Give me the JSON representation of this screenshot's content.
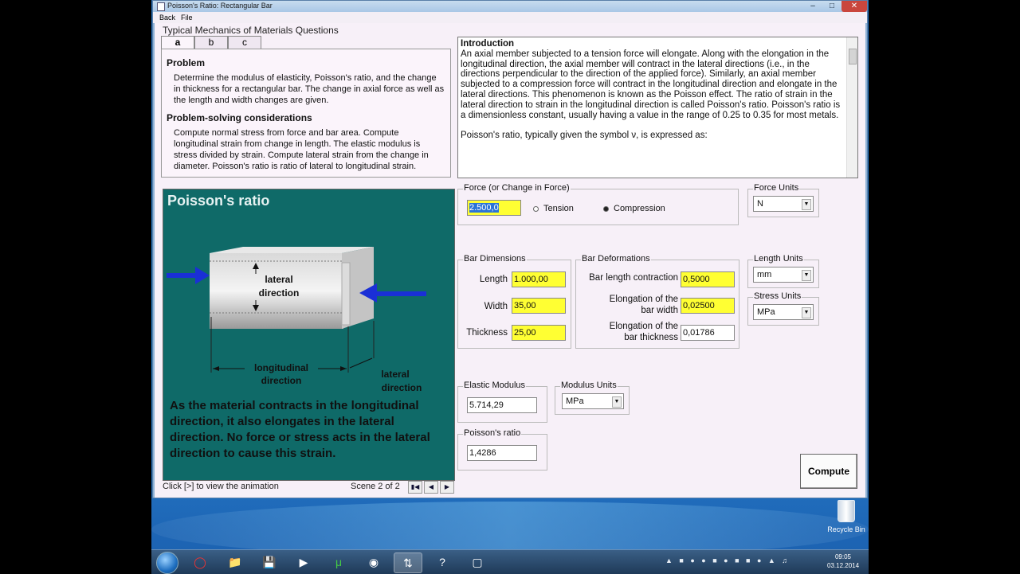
{
  "window": {
    "title": "Poisson's Ratio: Rectangular Bar",
    "menu": [
      "Back",
      "File"
    ]
  },
  "section_title": "Typical Mechanics of Materials Questions",
  "tabs": [
    {
      "label": "a"
    },
    {
      "label": "b"
    },
    {
      "label": "c"
    }
  ],
  "question": {
    "problem_heading": "Problem",
    "problem_text": "Determine the modulus of elasticity, Poisson's ratio, and the change in thickness for a rectangular bar.  The change in axial force as well as the length and width changes are given.",
    "considerations_heading": "Problem-solving considerations",
    "considerations_text": "Compute normal stress from force and bar area. Compute longitudinal strain from change in length. The elastic modulus is stress divided by strain. Compute lateral strain from the change in diameter. Poisson's ratio is ratio of lateral to longitudinal strain."
  },
  "intro": {
    "heading": "Introduction",
    "p1": "An axial member subjected to a tension force will elongate.  Along with the elongation in the longitudinal direction, the axial member will contract in the lateral directions (i.e., in the directions perpendicular to the direction of the applied force).  Similarly, an axial member subjected to a compression force will contract in the longitudinal direction and elongate in the lateral directions.  This phenomenon is known as the Poisson effect.  The ratio of strain in the lateral direction to strain in the longitudinal direction is called Poisson's ratio.  Poisson's ratio is a dimensionless constant, usually having a value in the range of 0.25 to 0.35 for most metals.",
    "p2": "Poisson's ratio, typically given the symbol ν,  is expressed as:"
  },
  "animation": {
    "title": "Poisson's ratio",
    "label_lateral_1": "lateral",
    "label_lateral_2": "direction",
    "label_longitudinal_1": "longitudinal",
    "label_longitudinal_2": "direction",
    "label_lateral_b1": "lateral",
    "label_lateral_b2": "direction",
    "caption": "As the material contracts in the longitudinal direction, it also elongates in the lateral direction.  No force or stress acts in the lateral direction to cause this strain.",
    "hint": "Click [>] to view the animation",
    "scene": "Scene 2 of 2",
    "colors": {
      "background": "#0f6a68",
      "arrow": "#1a2fd6"
    }
  },
  "force": {
    "group_label": "Force (or Change in Force)",
    "value": "2.500,0",
    "option_tension": "Tension",
    "option_compression": "Compression",
    "selected": "Compression"
  },
  "force_units": {
    "label": "Force Units",
    "value": "N"
  },
  "dimensions": {
    "group_label": "Bar Dimensions",
    "length_label": "Length",
    "length_value": "1.000,00",
    "width_label": "Width",
    "width_value": "35,00",
    "thickness_label": "Thickness",
    "thickness_value": "25,00"
  },
  "deformations": {
    "group_label": "Bar Deformations",
    "contraction_label": "Bar length contraction",
    "contraction_value": "0,5000",
    "width_elong_label_1": "Elongation of the",
    "width_elong_label_2": "bar width",
    "width_elong_value": "0,02500",
    "thick_elong_label_1": "Elongation of the",
    "thick_elong_label_2": "bar thickness",
    "thick_elong_value": "0,01786"
  },
  "length_units": {
    "label": "Length Units",
    "value": "mm"
  },
  "stress_units": {
    "label": "Stress Units",
    "value": "MPa"
  },
  "elastic_modulus": {
    "label": "Elastic Modulus",
    "value": "5.714,29"
  },
  "modulus_units": {
    "label": "Modulus Units",
    "value": "MPa"
  },
  "poissons_ratio": {
    "label": "Poisson's ratio",
    "value": "1,4286"
  },
  "compute_button": "Compute",
  "desktop": {
    "recycle_bin": "Recycle Bin"
  },
  "taskbar": {
    "time": "09:05",
    "date": "03.12.2014"
  }
}
